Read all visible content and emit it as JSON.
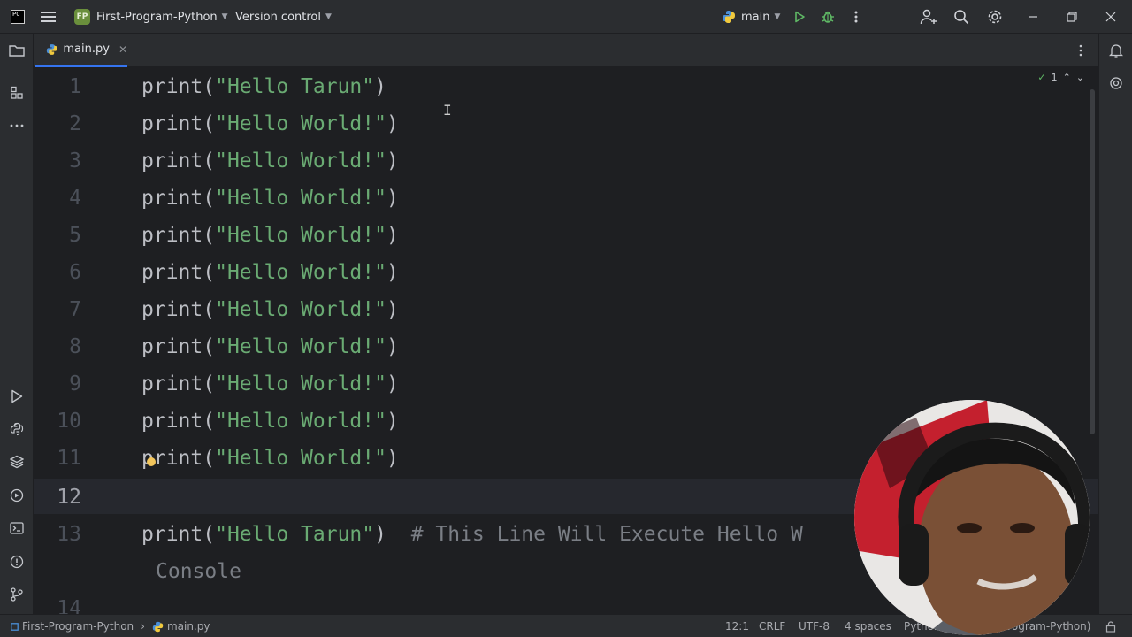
{
  "titlebar": {
    "project_badge": "FP",
    "project_name": "First-Program-Python",
    "vcs_label": "Version control",
    "run_config": "main"
  },
  "tabs": [
    {
      "label": "main.py",
      "active": true
    }
  ],
  "editor": {
    "inspection_count": "1",
    "lines": [
      {
        "num": "1",
        "fn": "print",
        "str": "\"Hello Tarun\""
      },
      {
        "num": "2",
        "fn": "print",
        "str": "\"Hello World!\""
      },
      {
        "num": "3",
        "fn": "print",
        "str": "\"Hello World!\""
      },
      {
        "num": "4",
        "fn": "print",
        "str": "\"Hello World!\""
      },
      {
        "num": "5",
        "fn": "print",
        "str": "\"Hello World!\""
      },
      {
        "num": "6",
        "fn": "print",
        "str": "\"Hello World!\""
      },
      {
        "num": "7",
        "fn": "print",
        "str": "\"Hello World!\""
      },
      {
        "num": "8",
        "fn": "print",
        "str": "\"Hello World!\""
      },
      {
        "num": "9",
        "fn": "print",
        "str": "\"Hello World!\""
      },
      {
        "num": "10",
        "fn": "print",
        "str": "\"Hello World!\""
      },
      {
        "num": "11",
        "fn": "print",
        "str": "\"Hello World!\""
      },
      {
        "num": "12",
        "fn": "",
        "str": ""
      },
      {
        "num": "13",
        "fn": "print",
        "str": "\"Hello Tarun\"",
        "comment": "# This Line Will Execute Hello W"
      },
      {
        "num": "",
        "fn": "",
        "str": "",
        "comment": "Console"
      },
      {
        "num": "14",
        "fn": "",
        "str": ""
      }
    ]
  },
  "statusbar": {
    "breadcrumb_project": "First-Program-Python",
    "breadcrumb_file": "main.py",
    "position": "12:1",
    "line_sep": "CRLF",
    "encoding": "UTF-8",
    "indent": "4 spaces",
    "interpreter": "Python 3.12 (First-Program-Python)"
  },
  "icons": {
    "app": "pycharm-logo-icon",
    "menu": "hamburger-icon",
    "run": "run-icon",
    "debug": "debug-icon",
    "search": "search-icon",
    "settings": "gear-icon",
    "add_user": "add-user-icon"
  },
  "colors": {
    "accent": "#3574f0",
    "string": "#6aab73",
    "run_green": "#5fb865"
  }
}
